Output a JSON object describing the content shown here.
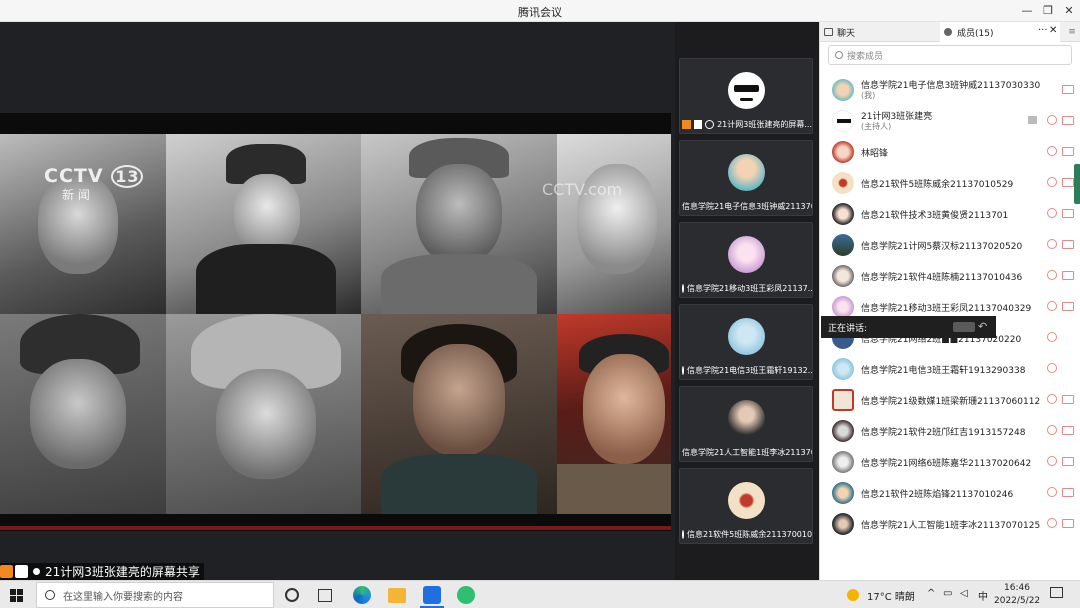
{
  "window": {
    "title": "腾讯会议"
  },
  "share": {
    "label": "21计网3班张建亮的屏幕共享",
    "logo_main": "CCTV",
    "logo_num": "13",
    "logo_sub": "新 闻",
    "logo_watermark": "CCTV.com"
  },
  "tiles": [
    {
      "name": "21计网3班张建亮的屏幕..."
    },
    {
      "name": "信息学院21电子信息3班钟威211370..."
    },
    {
      "name": "信息学院21移动3班王彩凤21137..."
    },
    {
      "name": "信息学院21电信3班王霜轩19132..."
    },
    {
      "name": "信息学院21人工智能1班李冰211370..."
    },
    {
      "name": "信息21软件5班陈威余211370010..."
    }
  ],
  "panel": {
    "tab_chat": "聊天",
    "tab_members": "成员(15)",
    "search_placeholder": "搜索成员",
    "speaking_label": "正在讲话:",
    "members": [
      {
        "name": "信息学院21电子信息3班钟威21137030330",
        "sub": "(我)"
      },
      {
        "name": "21计网3班张建亮",
        "sub": "(主持人)"
      },
      {
        "name": "林昭锋",
        "sub": ""
      },
      {
        "name": "信息21软件5班陈威余21137010529",
        "sub": ""
      },
      {
        "name": "信息21软件技术3班黄俊贤2113701",
        "sub": ""
      },
      {
        "name": "信息学院21计网5蔡汉标21137020520",
        "sub": ""
      },
      {
        "name": "信息学院21软件4班陈楠21137010436",
        "sub": ""
      },
      {
        "name": "信息学院21移动3班王彩凤21137040329",
        "sub": ""
      },
      {
        "name": "信息学院21网络2班■■21137020220",
        "sub": ""
      },
      {
        "name": "信息学院21电信3班王霜轩1913290338",
        "sub": ""
      },
      {
        "name": "信息学院21级数媒1班梁新珊21137060112",
        "sub": ""
      },
      {
        "name": "信息学院21软件2班邝红吉1913157248",
        "sub": ""
      },
      {
        "name": "信息学院21网络6班陈嘉华21137020642",
        "sub": ""
      },
      {
        "name": "信息21软件2班陈焰锋21137010246",
        "sub": ""
      },
      {
        "name": "信息学院21人工智能1班李冰21137070125",
        "sub": ""
      }
    ]
  },
  "taskbar": {
    "search_placeholder": "在这里输入你要搜索的内容",
    "weather": "17°C 晴朗",
    "ime": "中",
    "time": "16:46",
    "date": "2022/5/22"
  }
}
